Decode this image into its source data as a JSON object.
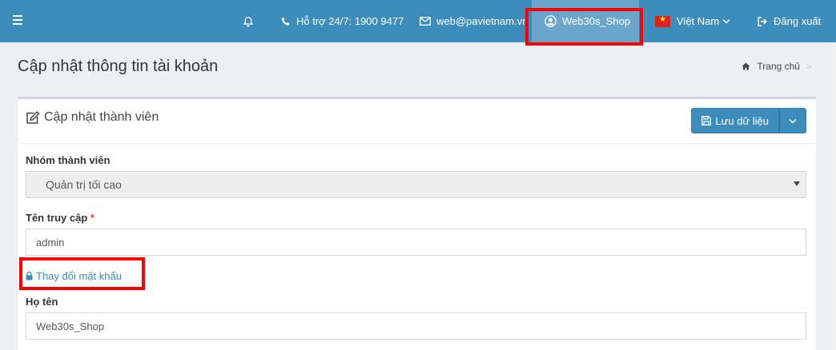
{
  "topnav": {
    "support": "Hỗ trợ 24/7: 1900 9477",
    "email": "web@pavietnam.vn",
    "user": "Web30s_Shop",
    "language": "Việt Nam",
    "logout": "Đăng xuất"
  },
  "header": {
    "title": "Cập nhật thông tin tài khoản",
    "breadcrumb_home": "Trang chủ",
    "breadcrumb_sep": ">"
  },
  "panel": {
    "title": "Cập nhật thành viên",
    "save_label": "Lưu dữ liệu"
  },
  "form": {
    "group_label": "Nhóm thành viên",
    "group_value": "Quản trị tối cao",
    "username_label": "Tên truy cập",
    "required_mark": "*",
    "username_value": "admin",
    "change_password": "Thay đổi mật khẩu",
    "fullname_label": "Họ tên",
    "fullname_value": "Web30s_Shop"
  },
  "colors": {
    "nav_bg": "#3c8dbc",
    "highlight": "#ff0000",
    "required": "#dd4b39"
  }
}
